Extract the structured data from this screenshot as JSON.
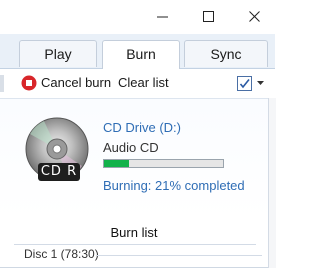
{
  "window": {
    "controls": [
      "minimize",
      "maximize",
      "close"
    ]
  },
  "tabs": [
    {
      "label": "Play",
      "selected": false
    },
    {
      "label": "Burn",
      "selected": true
    },
    {
      "label": "Sync",
      "selected": false
    }
  ],
  "toolbar": {
    "cancel_label": "Cancel burn",
    "clear_label": "Clear list",
    "cancel_icon": "stop-icon",
    "options_icon": "list-options-checkbox-icon",
    "cancel_icon_color": "#d8262a"
  },
  "drive": {
    "name": "CD Drive (D:)",
    "disc_type": "Audio CD",
    "disc_badge": "CD R",
    "progress_fraction": 0.21,
    "status": "Burning: 21% completed",
    "progress_color": "#12b24a",
    "link_color": "#2f6db5"
  },
  "burn_list": {
    "header": "Burn list",
    "groups": [
      {
        "label": "Disc 1 (78:30)"
      }
    ]
  }
}
